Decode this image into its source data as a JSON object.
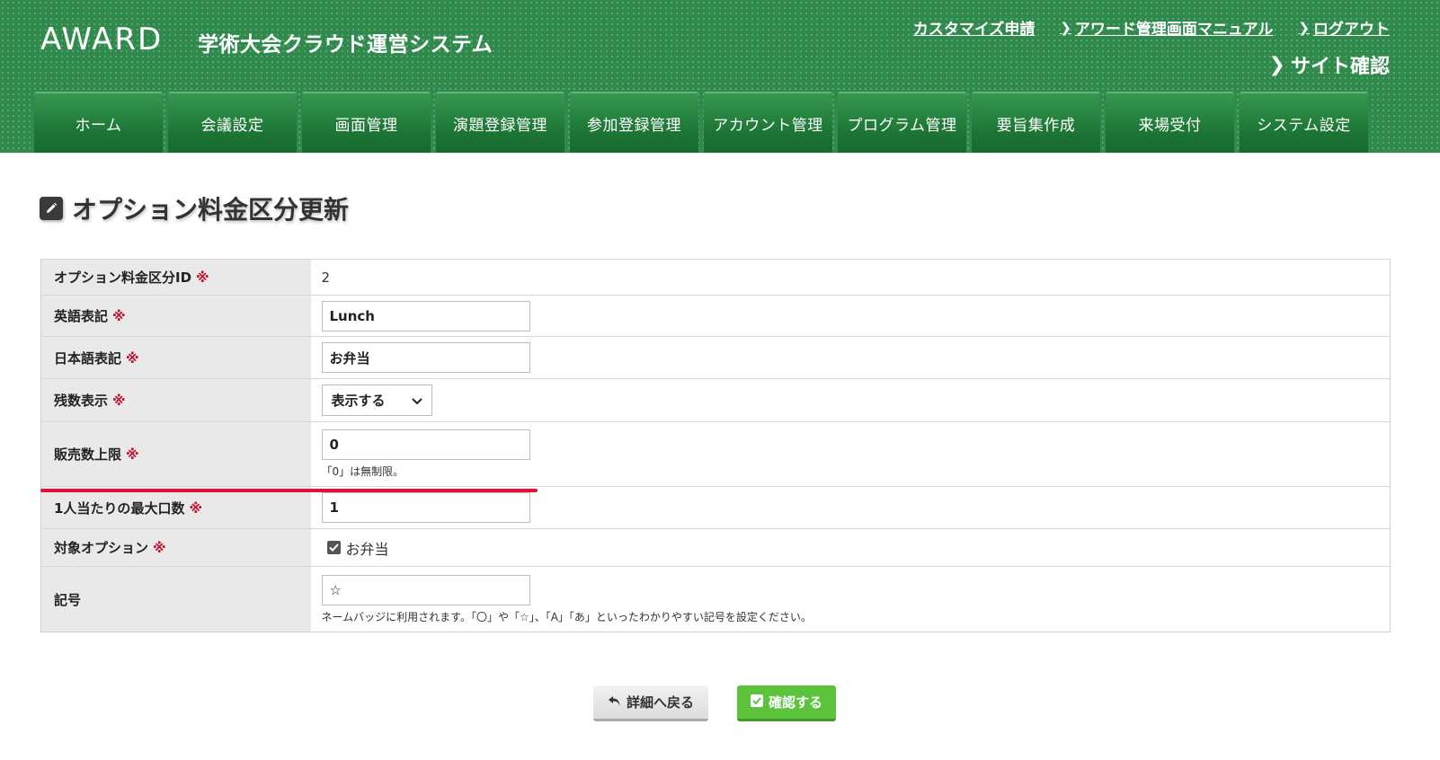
{
  "header": {
    "logo": "AWARD",
    "app_title": "学術大会クラウド運営システム",
    "links": [
      "カスタマイズ申請",
      "アワード管理画面マニュアル",
      "ログアウト"
    ],
    "site_check": "サイト確認"
  },
  "nav": {
    "tabs": [
      "ホーム",
      "会議設定",
      "画面管理",
      "演題登録管理",
      "参加登録管理",
      "アカウント管理",
      "プログラム管理",
      "要旨集作成",
      "来場受付",
      "システム設定"
    ]
  },
  "page": {
    "title": "オプション料金区分更新"
  },
  "form": {
    "required_mark": "※",
    "rows": {
      "option_id": {
        "label": "オプション料金区分ID",
        "value": "2"
      },
      "english": {
        "label": "英語表記",
        "value": "Lunch"
      },
      "japanese": {
        "label": "日本語表記",
        "value": "お弁当"
      },
      "remaining": {
        "label": "残数表示",
        "selected": "表示する"
      },
      "sales_limit": {
        "label": "販売数上限",
        "value": "0",
        "help": "「0」は無制限。"
      },
      "max_per_person": {
        "label": "1人当たりの最大口数",
        "value": "1"
      },
      "target_option": {
        "label": "対象オプション",
        "option": "お弁当",
        "checked": true
      },
      "symbol": {
        "label": "記号",
        "value": "☆",
        "help": "ネームバッジに利用されます。「〇」や「☆」、「A」「あ」といったわかりやすい記号を設定ください。"
      }
    }
  },
  "buttons": {
    "back": "詳細へ戻る",
    "confirm": "確認する"
  },
  "colors": {
    "header_green": "#2f8a4c",
    "tab_green": "#1b7334",
    "required_red": "#c0142e",
    "confirm_green": "#5cc33d",
    "highlight_red": "#e0113c"
  }
}
